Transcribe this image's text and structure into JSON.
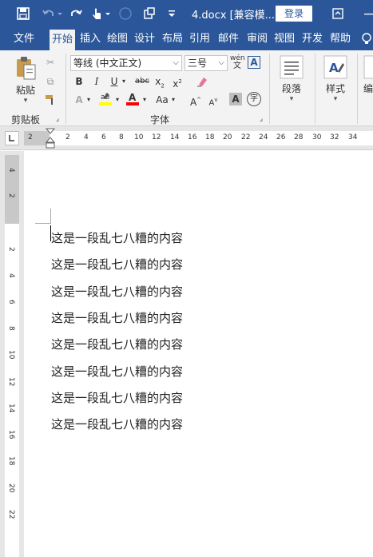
{
  "titlebar": {
    "title": "4.docx [兼容模...",
    "login_label": "登录"
  },
  "tabs": [
    {
      "label": "文件"
    },
    {
      "label": "开始"
    },
    {
      "label": "插入"
    },
    {
      "label": "绘图"
    },
    {
      "label": "设计"
    },
    {
      "label": "布局"
    },
    {
      "label": "引用"
    },
    {
      "label": "邮件"
    },
    {
      "label": "审阅"
    },
    {
      "label": "视图"
    },
    {
      "label": "开发"
    },
    {
      "label": "帮助"
    }
  ],
  "ribbon": {
    "paste_label": "粘贴",
    "clipboard_group": "剪贴板",
    "font_name": "等线 (中文正文)",
    "font_size": "三号",
    "phonetic_label": "wén",
    "font_group": "字体",
    "paragraph_label": "段落",
    "styles_label": "样式",
    "edit_label": "编"
  },
  "ruler": {
    "h_numbers": [
      "2",
      "2",
      "4",
      "6",
      "8",
      "10",
      "12",
      "14",
      "16",
      "18",
      "20",
      "22",
      "24",
      "26",
      "28",
      "30",
      "32",
      "34"
    ],
    "v_numbers": [
      "4",
      "2",
      "2",
      "4",
      "6",
      "8",
      "10",
      "12",
      "14",
      "16",
      "18",
      "20",
      "22"
    ]
  },
  "document": {
    "lines": [
      "这是一段乱七八糟的内容",
      "这是一段乱七八糟的内容",
      "这是一段乱七八糟的内容",
      "这是一段乱七八糟的内容",
      "这是一段乱七八糟的内容",
      "这是一段乱七八糟的内容",
      "这是一段乱七八糟的内容",
      "这是一段乱七八糟的内容"
    ]
  },
  "colors": {
    "brand": "#2b579a",
    "ribbon_bg": "#f3f3f3",
    "highlight": "#ffff00",
    "font_color": "#ff0000"
  }
}
